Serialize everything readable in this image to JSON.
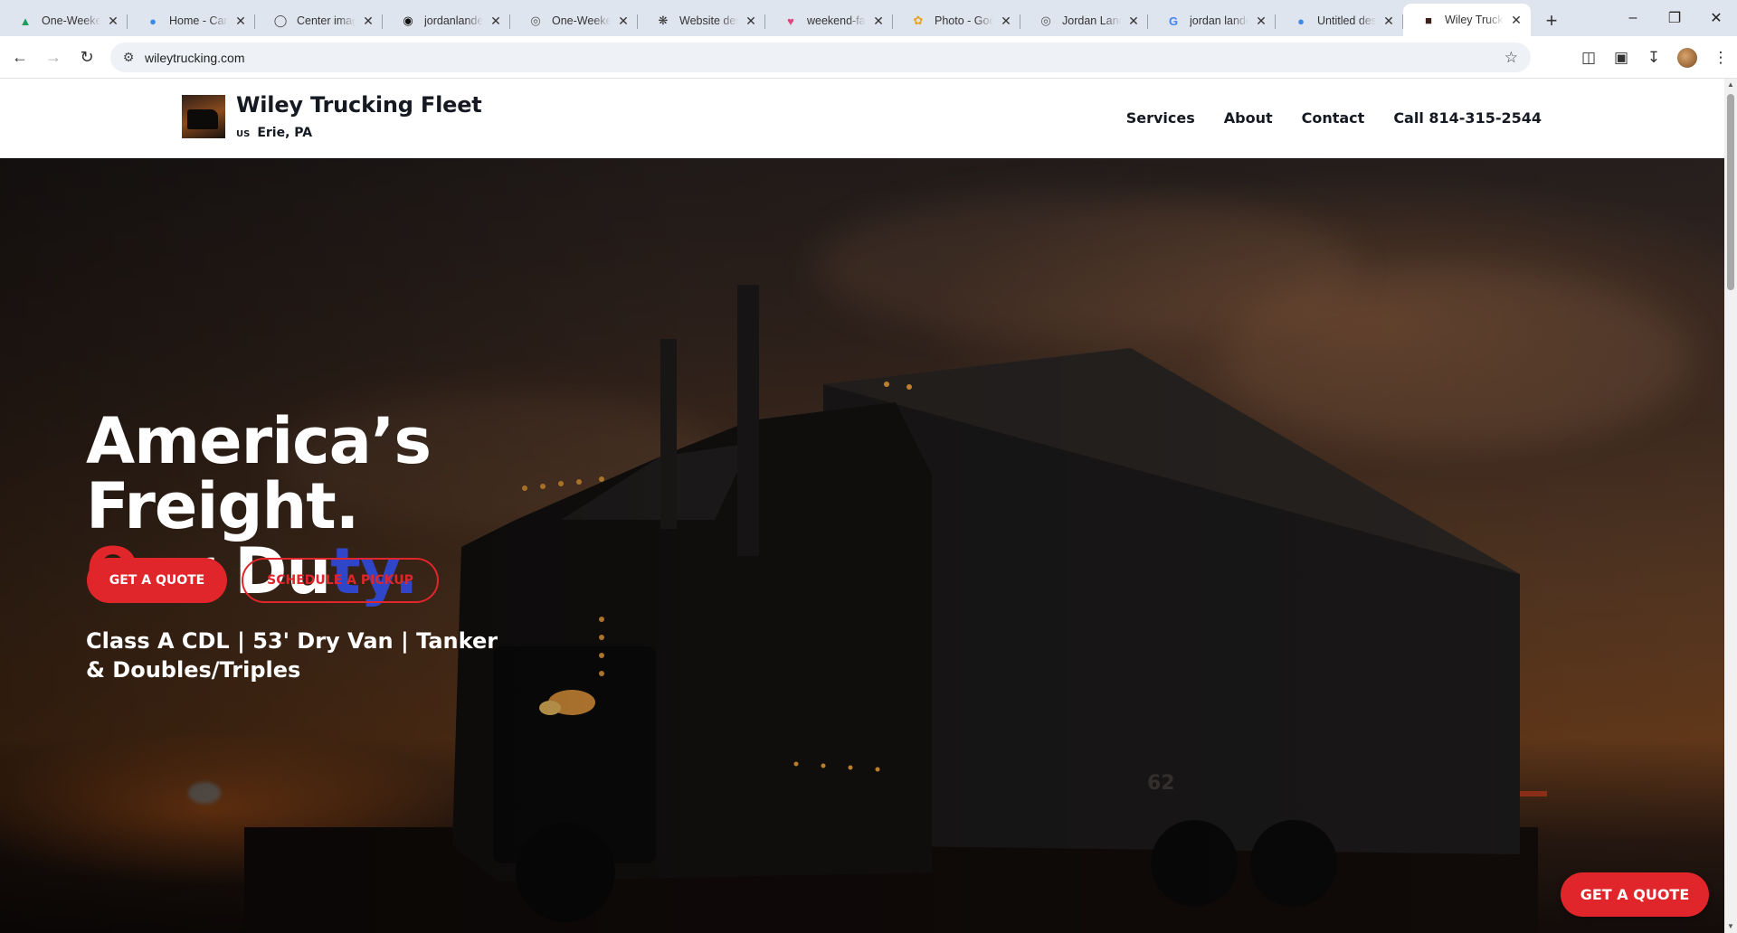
{
  "browser": {
    "tabs": [
      {
        "title": "One-Weekend",
        "icon": "google-drive-icon",
        "active": false
      },
      {
        "title": "Home - Canva",
        "icon": "canva-icon",
        "active": false
      },
      {
        "title": "Center image",
        "icon": "web-icon",
        "active": false
      },
      {
        "title": "jordanlander",
        "icon": "github-icon",
        "active": false
      },
      {
        "title": "One-Weekend",
        "icon": "globe-icon",
        "active": false
      },
      {
        "title": "Website design",
        "icon": "chatgpt-icon",
        "active": false
      },
      {
        "title": "weekend-facts",
        "icon": "app-icon",
        "active": false
      },
      {
        "title": "Photo - Google",
        "icon": "google-photos-icon",
        "active": false
      },
      {
        "title": "Jordan Lander",
        "icon": "globe-icon",
        "active": false
      },
      {
        "title": "jordan lander",
        "icon": "google-icon",
        "active": false
      },
      {
        "title": "Untitled design",
        "icon": "canva-icon",
        "active": false
      },
      {
        "title": "Wiley Trucking",
        "icon": "site-favicon",
        "active": true
      }
    ],
    "url": "wileytrucking.com"
  },
  "site": {
    "brand_name": "Wiley Trucking Fleet",
    "flag_label": "US",
    "location": "Erie, PA",
    "nav": [
      "Services",
      "About",
      "Contact",
      "Call 814-315-2544"
    ]
  },
  "hero": {
    "title_line1": "America’s",
    "title_line2": "Freight.",
    "title_line3": {
      "red": "Ou",
      "white_a": "r",
      "white_b": " Du",
      "blue": "ty."
    },
    "subtitle": "Class A CDL | 53' Dry Van | Tanker & Doubles/Triples",
    "primary_button": "GET A QUOTE",
    "secondary_button": "SCHEDULE A PICKUP",
    "floating_button": "GET A QUOTE",
    "trailer_number": "62"
  },
  "colors": {
    "accent_red": "#e0262b",
    "accent_blue": "#2f46c8",
    "header_text": "#151922"
  }
}
